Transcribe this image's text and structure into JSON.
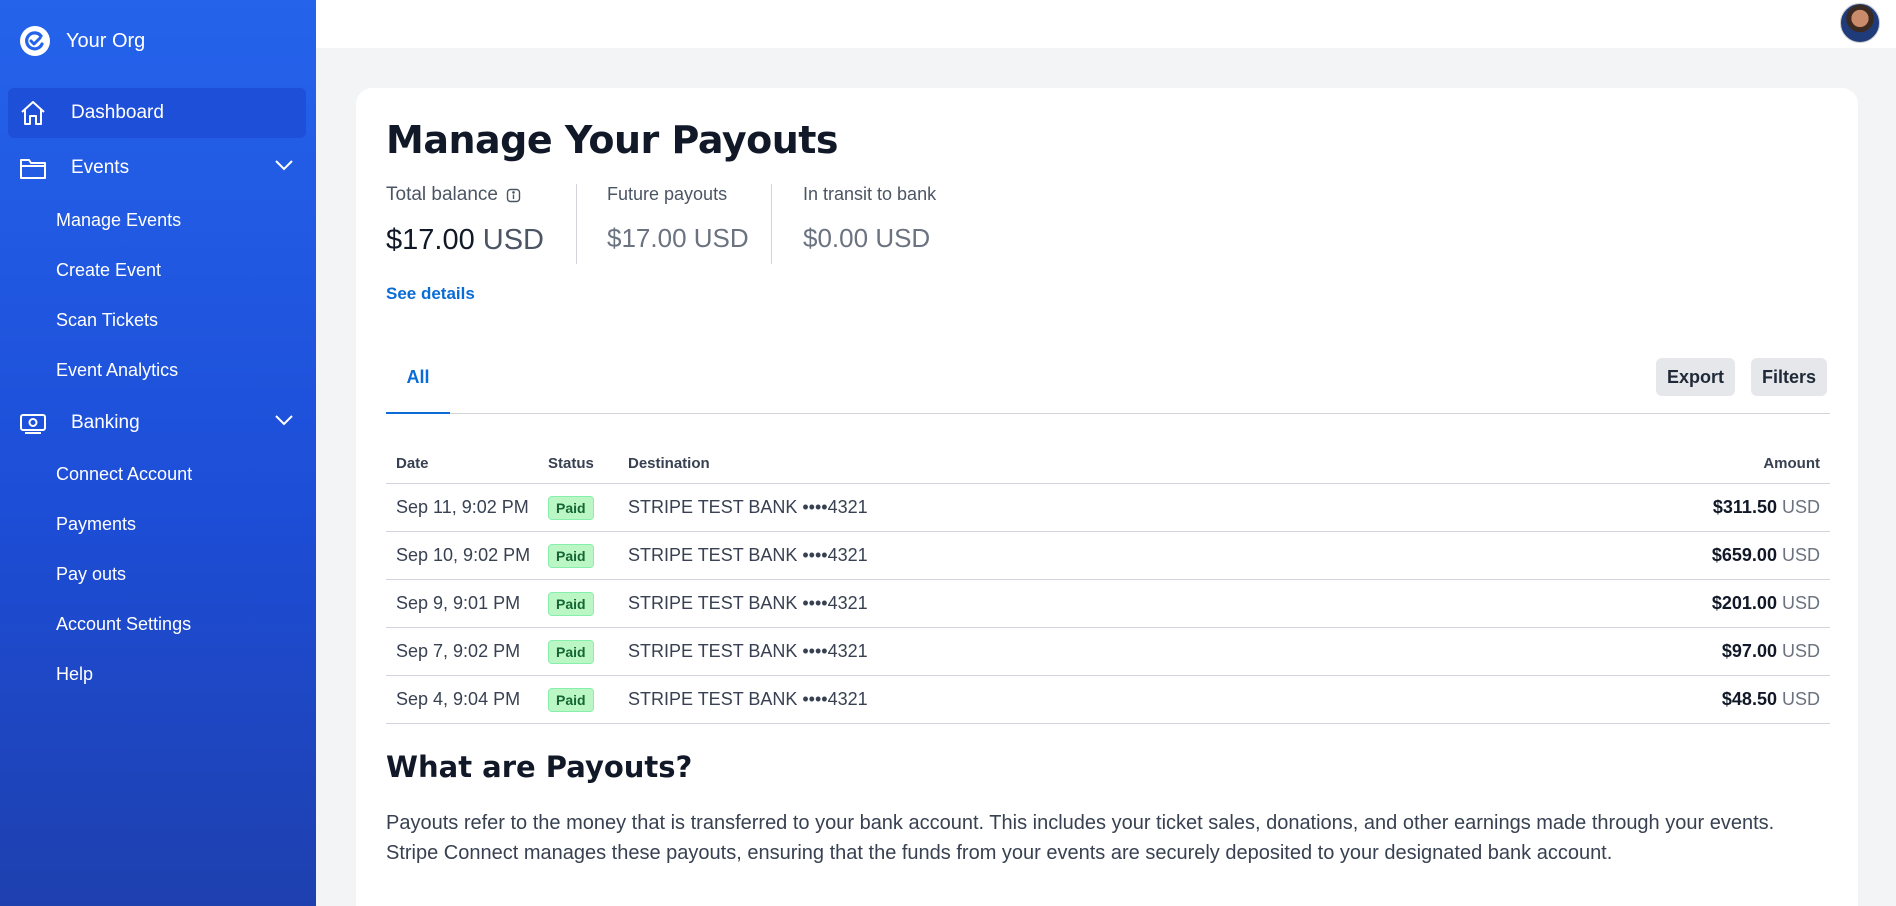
{
  "brand": {
    "name": "Your Org"
  },
  "nav": {
    "dashboard": "Dashboard",
    "events": "Events",
    "events_items": [
      "Manage Events",
      "Create Event",
      "Scan Tickets",
      "Event Analytics"
    ],
    "banking": "Banking",
    "banking_items": [
      "Connect Account",
      "Payments",
      "Pay outs",
      "Account Settings",
      "Help"
    ]
  },
  "page": {
    "title": "Manage Your Payouts",
    "stats": {
      "total_label": "Total balance",
      "total_value": "$17.00",
      "total_currency": "USD",
      "future_label": "Future payouts",
      "future_value": "$17.00",
      "future_currency": "USD",
      "transit_label": "In transit to bank",
      "transit_value": "$0.00",
      "transit_currency": "USD"
    },
    "see_details": "See details",
    "tab_all": "All",
    "export": "Export",
    "filters": "Filters"
  },
  "table": {
    "headers": {
      "date": "Date",
      "status": "Status",
      "destination": "Destination",
      "amount": "Amount"
    },
    "rows": [
      {
        "date": "Sep 11, 9:02 PM",
        "status": "Paid",
        "destination": "STRIPE TEST BANK ••••4321",
        "amount": "$311.50",
        "currency": "USD"
      },
      {
        "date": "Sep 10, 9:02 PM",
        "status": "Paid",
        "destination": "STRIPE TEST BANK ••••4321",
        "amount": "$659.00",
        "currency": "USD"
      },
      {
        "date": "Sep 9, 9:01 PM",
        "status": "Paid",
        "destination": "STRIPE TEST BANK ••••4321",
        "amount": "$201.00",
        "currency": "USD"
      },
      {
        "date": "Sep 7, 9:02 PM",
        "status": "Paid",
        "destination": "STRIPE TEST BANK ••••4321",
        "amount": "$97.00",
        "currency": "USD"
      },
      {
        "date": "Sep 4, 9:04 PM",
        "status": "Paid",
        "destination": "STRIPE TEST BANK ••••4321",
        "amount": "$48.50",
        "currency": "USD"
      }
    ]
  },
  "info": {
    "title": "What are Payouts?",
    "body": "Payouts refer to the money that is transferred to your bank account. This includes your ticket sales, donations, and other earnings made through your events. Stripe Connect manages these payouts, ensuring that the funds from your events are securely deposited to your designated bank account."
  },
  "colors": {
    "sidebar": "#2563eb",
    "accent": "#0a6cd6",
    "paid_badge": "#bbf7c4"
  }
}
